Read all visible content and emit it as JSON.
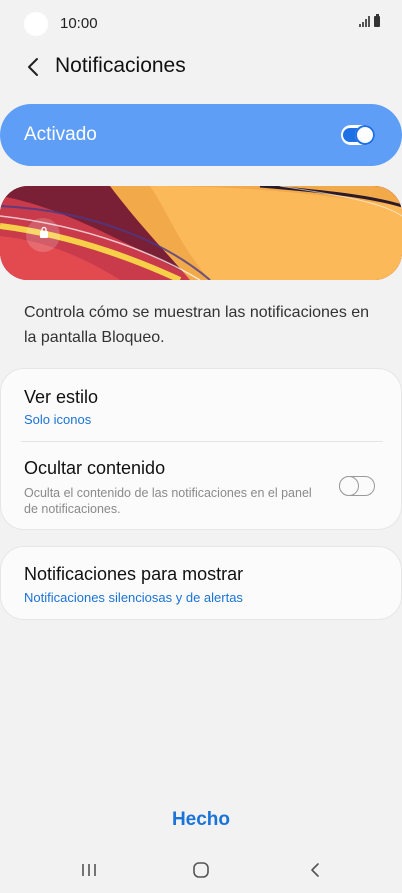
{
  "status_bar": {
    "time": "10:00"
  },
  "header": {
    "title": "Notificaciones"
  },
  "master": {
    "label": "Activado",
    "enabled": true
  },
  "description": "Controla cómo se muestran las notificaciones en la pantalla Bloqueo.",
  "settings": {
    "view_style": {
      "title": "Ver estilo",
      "value": "Solo iconos"
    },
    "hide_content": {
      "title": "Ocultar contenido",
      "description": "Oculta el contenido de las notificaciones en el panel de notificaciones.",
      "enabled": false
    },
    "notifications_to_show": {
      "title": "Notificaciones para mostrar",
      "value": "Notificaciones silenciosas y de alertas"
    }
  },
  "footer": {
    "done_label": "Hecho"
  },
  "colors": {
    "accent": "#1a73d8",
    "master_bg": "#5e9ef6",
    "background": "#f2f2f2"
  },
  "icons": [
    "back-arrow-icon",
    "signal-icon",
    "battery-icon",
    "lock-icon",
    "recents-icon",
    "home-icon",
    "nav-back-icon"
  ]
}
